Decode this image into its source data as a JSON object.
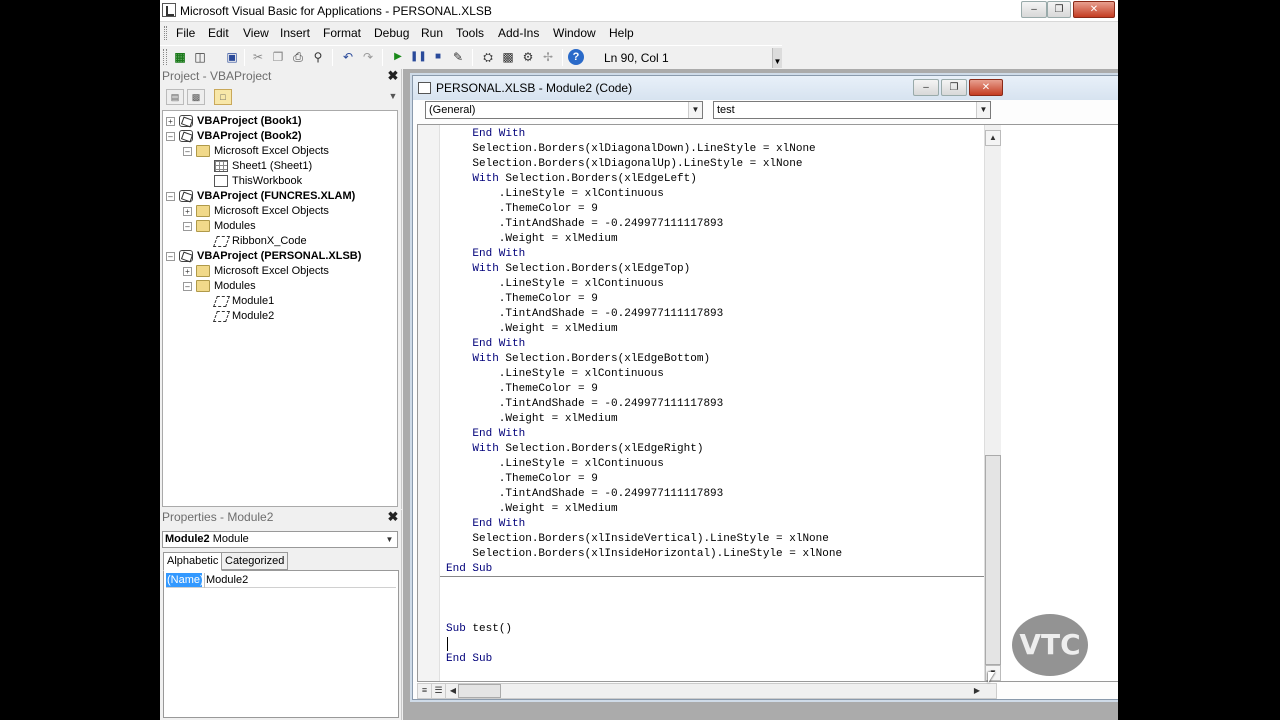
{
  "window": {
    "title": "Microsoft Visual Basic for Applications - PERSONAL.XLSB",
    "minimize": "–",
    "restore": "❐",
    "close": "✕"
  },
  "menu": [
    "File",
    "Edit",
    "View",
    "Insert",
    "Format",
    "Debug",
    "Run",
    "Tools",
    "Add-Ins",
    "Window",
    "Help"
  ],
  "toolbar": {
    "position": "Ln 90, Col 1"
  },
  "project": {
    "title": "Project - VBAProject",
    "close": "✖",
    "tree": [
      "VBAProject (Book1)",
      "VBAProject (Book2)",
      "Microsoft Excel Objects",
      "Sheet1 (Sheet1)",
      "ThisWorkbook",
      "VBAProject (FUNCRES.XLAM)",
      "Microsoft Excel Objects",
      "Modules",
      "RibbonX_Code",
      "VBAProject (PERSONAL.XLSB)",
      "Microsoft Excel Objects",
      "Modules",
      "Module1",
      "Module2"
    ]
  },
  "properties": {
    "title": "Properties - Module2",
    "close": "✖",
    "object_name": "Module2",
    "object_type": "Module",
    "tabs": [
      "Alphabetic",
      "Categorized"
    ],
    "rows": [
      {
        "key": "(Name)",
        "value": "Module2"
      }
    ]
  },
  "code_window": {
    "title": "PERSONAL.XLSB - Module2 (Code)",
    "object_combo": "(General)",
    "proc_combo": "test",
    "lines": [
      "    End With",
      "    Selection.Borders(xlDiagonalDown).LineStyle = xlNone",
      "    Selection.Borders(xlDiagonalUp).LineStyle = xlNone",
      "    With Selection.Borders(xlEdgeLeft)",
      "        .LineStyle = xlContinuous",
      "        .ThemeColor = 9",
      "        .TintAndShade = -0.249977111117893",
      "        .Weight = xlMedium",
      "    End With",
      "    With Selection.Borders(xlEdgeTop)",
      "        .LineStyle = xlContinuous",
      "        .ThemeColor = 9",
      "        .TintAndShade = -0.249977111117893",
      "        .Weight = xlMedium",
      "    End With",
      "    With Selection.Borders(xlEdgeBottom)",
      "        .LineStyle = xlContinuous",
      "        .ThemeColor = 9",
      "        .TintAndShade = -0.249977111117893",
      "        .Weight = xlMedium",
      "    End With",
      "    With Selection.Borders(xlEdgeRight)",
      "        .LineStyle = xlContinuous",
      "        .ThemeColor = 9",
      "        .TintAndShade = -0.249977111117893",
      "        .Weight = xlMedium",
      "    End With",
      "    Selection.Borders(xlInsideVertical).LineStyle = xlNone",
      "    Selection.Borders(xlInsideHorizontal).LineStyle = xlNone",
      "End Sub",
      "",
      "",
      "",
      "Sub test()",
      "",
      "End Sub"
    ]
  },
  "watermark": "VTC",
  "colors": {
    "selection": "#3399ff",
    "keyword": "#00007a",
    "mdi_background": "#ababab"
  }
}
